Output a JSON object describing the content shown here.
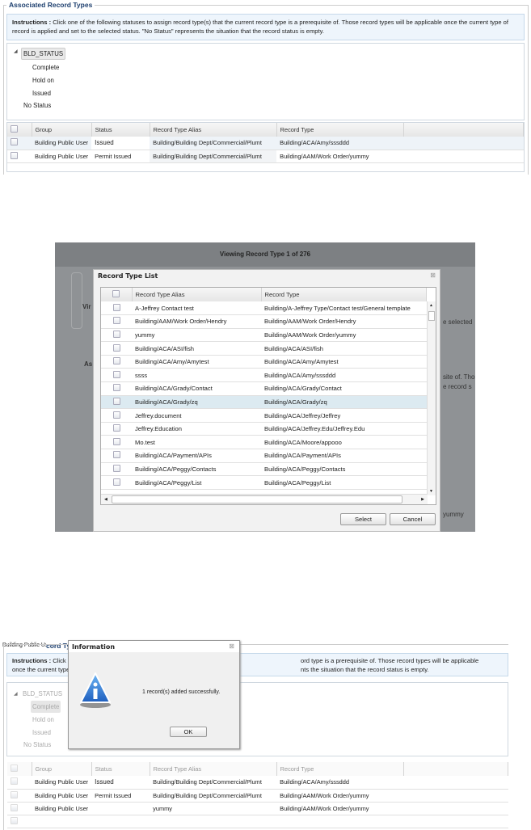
{
  "panel1": {
    "legend": "Associated Record Types",
    "instructions_label": "Instructions :",
    "instructions_text": " Click one of the following statuses to assign record type(s) that the current record type is a prerequisite of. Those record types will be applicable once the current type of record is applied and set to the selected status. \"No Status\" represents the situation that the record status is empty.",
    "tree": {
      "root": "BLD_STATUS",
      "children": [
        "Complete",
        "Hold on",
        "Issued"
      ],
      "no_status": "No Status"
    },
    "columns": [
      "Group",
      "Status",
      "Record Type Alias",
      "Record Type"
    ],
    "rows": [
      {
        "group": "Building Public User",
        "status": "Issued",
        "alias": "Building/Building Dept/Commercial/Plumt",
        "type": "Building/ACA/Amy/sssddd"
      },
      {
        "group": "Building Public User",
        "status": "Permit Issued",
        "alias": "Building/Building Dept/Commercial/Plumt",
        "type": "Building/AAM/Work Order/yummy"
      }
    ]
  },
  "panel2": {
    "viewing": "Viewing Record Type 1  of  276",
    "dialog_title": "Record Type List",
    "columns": [
      "Record Type Alias",
      "Record Type"
    ],
    "rows": [
      {
        "alias": "A-Jeffrey Contact test",
        "type": "Building/A-Jeffrey Type/Contact test/General template"
      },
      {
        "alias": "Building/AAM/Work Order/Hendry",
        "type": "Building/AAM/Work Order/Hendry"
      },
      {
        "alias": "yummy",
        "type": "Building/AAM/Work Order/yummy"
      },
      {
        "alias": "Building/ACA/ASI/fish",
        "type": "Building/ACA/ASI/fish"
      },
      {
        "alias": "Building/ACA/Amy/Amytest",
        "type": "Building/ACA/Amy/Amytest"
      },
      {
        "alias": "ssss",
        "type": "Building/ACA/Amy/sssddd"
      },
      {
        "alias": "Building/ACA/Grady/Contact",
        "type": "Building/ACA/Grady/Contact"
      },
      {
        "alias": "Building/ACA/Grady/zq",
        "type": "Building/ACA/Grady/zq"
      },
      {
        "alias": "Jeffrey.document",
        "type": "Building/ACA/Jeffrey/Jeffrey"
      },
      {
        "alias": "Jeffrey.Education",
        "type": "Building/ACA/Jeffrey.Edu/Jeffrey.Edu"
      },
      {
        "alias": "Mo.test",
        "type": "Building/ACA/Moore/appooo"
      },
      {
        "alias": "Building/ACA/Payment/APIs",
        "type": "Building/ACA/Payment/APIs"
      },
      {
        "alias": "Building/ACA/Peggy/Contacts",
        "type": "Building/ACA/Peggy/Contacts"
      },
      {
        "alias": "Building/ACA/Peggy/List",
        "type": "Building/ACA/Peggy/List"
      }
    ],
    "select_label": "Select",
    "cancel_label": "Cancel",
    "bg_fragments": {
      "a": "Vir",
      "b": "As",
      "c": "e selected",
      "d": "site of. Tho",
      "e": "e record s",
      "f": "yummy"
    }
  },
  "panel3": {
    "corner_text": "Building Public User",
    "legend_frag": "cord Ty",
    "instr_left_1": "Instructions :",
    "instr_left_1b": " Click on",
    "instr_left_2": "once the current type o",
    "instr_right_1": "ord type is a prerequisite of. Those record types will be applicable",
    "instr_right_2": "nts the situation that the record status is empty.",
    "dialog_title": "Information",
    "message": "1 record(s) added successfully.",
    "ok_label": "OK",
    "tree": {
      "root": "BLD_STATUS",
      "children": [
        "Complete",
        "Hold on",
        "Issued"
      ],
      "no_status": "No Status"
    },
    "columns": [
      "Group",
      "Status",
      "Record Type Alias",
      "Record Type"
    ],
    "rows": [
      {
        "group": "Building Public User",
        "status": "Issued",
        "alias": "Building/Building Dept/Commercial/Plumt",
        "type": "Building/ACA/Amy/sssddd"
      },
      {
        "group": "Building Public User",
        "status": "Permit Issued",
        "alias": "Building/Building Dept/Commercial/Plumt",
        "type": "Building/AAM/Work Order/yummy"
      },
      {
        "group": "Building Public User",
        "status": "",
        "alias": "yummy",
        "type": "Building/AAM/Work Order/yummy"
      }
    ]
  }
}
